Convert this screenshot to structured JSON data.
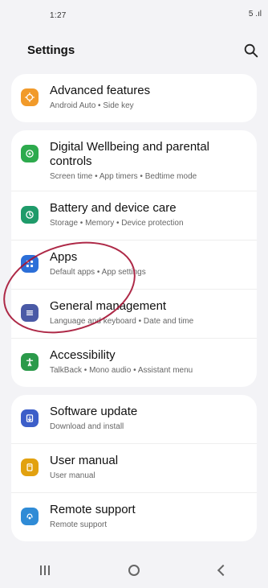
{
  "status": {
    "time": "1:27",
    "right": "5 .ıl"
  },
  "header": {
    "title": "Settings"
  },
  "colors": {
    "advanced": "#f19a2a",
    "digital_wellbeing": "#2daa4d",
    "battery": "#1f9b6a",
    "apps": "#2c6fd8",
    "general_management": "#4a5aa6",
    "accessibility": "#2b9a4a",
    "software_update": "#3c5ec9",
    "user_manual": "#e2a10f",
    "remote_support": "#2f8bd6",
    "annotation_circle": "#a51233"
  },
  "items": [
    {
      "label": "Advanced features",
      "sub": "Android Auto • Side key",
      "icon": "gear-plus-icon"
    },
    {
      "label": "Digital Wellbeing and parental controls",
      "sub": "Screen time • App timers • Bedtime mode",
      "icon": "wellbeing-icon"
    },
    {
      "label": "Battery and device care",
      "sub": "Storage • Memory • Device protection",
      "icon": "battery-icon"
    },
    {
      "label": "Apps",
      "sub": "Default apps • App settings",
      "icon": "apps-grid-icon"
    },
    {
      "label": "General management",
      "sub": "Language and keyboard • Date and time",
      "icon": "general-management-icon"
    },
    {
      "label": "Accessibility",
      "sub": "TalkBack • Mono audio • Assistant menu",
      "icon": "accessibility-icon"
    },
    {
      "label": "Software update",
      "sub": "Download and install",
      "icon": "software-update-icon"
    },
    {
      "label": "User manual",
      "sub": "User manual",
      "icon": "manual-icon"
    },
    {
      "label": "Remote support",
      "sub": "Remote support",
      "icon": "remote-support-icon"
    }
  ],
  "nav": {
    "recent": "recent-apps-icon",
    "home": "home-icon",
    "back": "back-icon"
  }
}
